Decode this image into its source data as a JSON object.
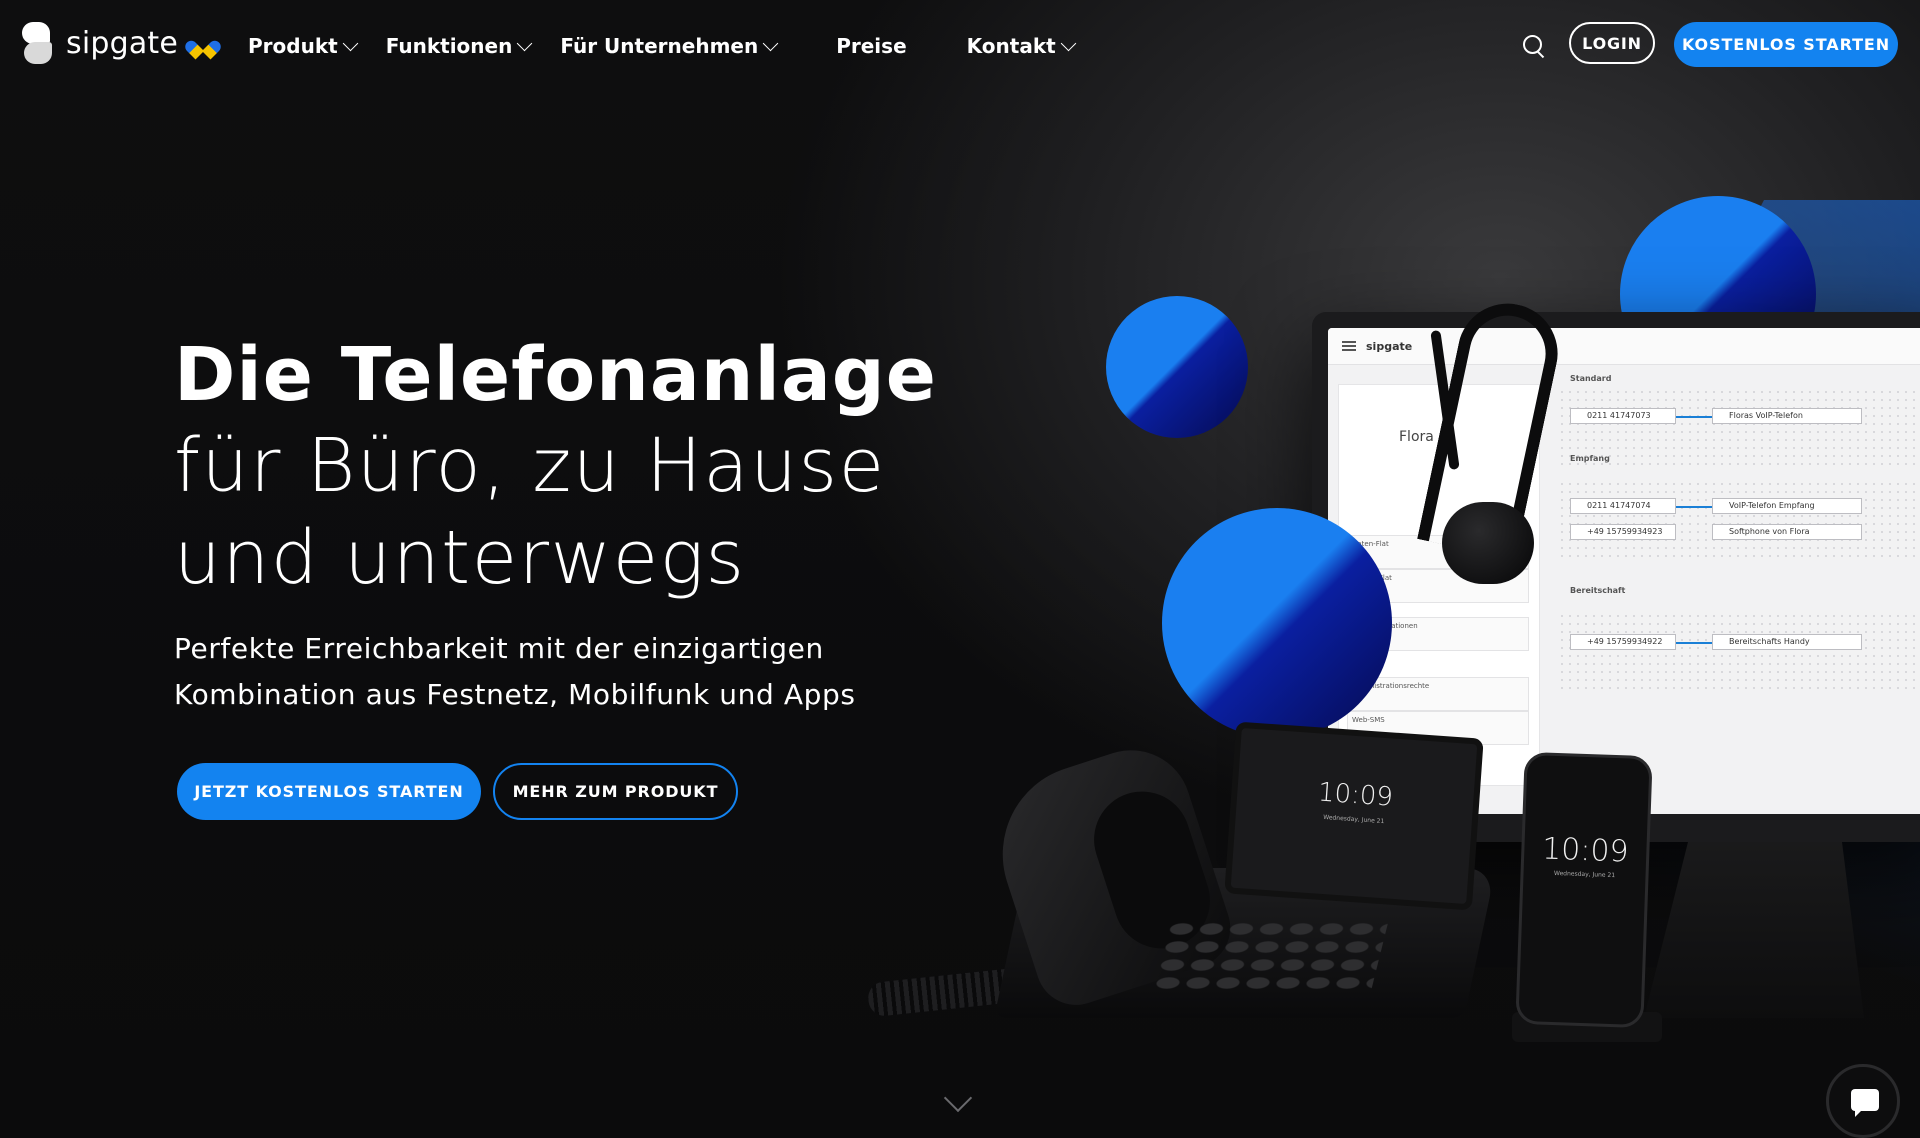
{
  "brand": {
    "name": "sipgate",
    "accent": "#1383f0"
  },
  "nav": {
    "items": [
      {
        "label": "Produkt",
        "dropdown": true
      },
      {
        "label": "Funktionen",
        "dropdown": true
      },
      {
        "label": "Für Unternehmen",
        "dropdown": true
      },
      {
        "label": "Preise",
        "dropdown": false
      },
      {
        "label": "Kontakt",
        "dropdown": true
      }
    ],
    "login_label": "LOGIN",
    "start_label": "KOSTENLOS STARTEN"
  },
  "hero": {
    "title_bold": "Die Telefonanlage",
    "title_light": [
      "für Büro, zu Hause",
      "und unterwegs"
    ],
    "subtitle": [
      "Perfekte Erreichbarkeit mit der einzigartigen",
      "Kombination aus Festnetz, Mobilfunk und Apps"
    ],
    "cta_primary": "JETZT KOSTENLOS STARTEN",
    "cta_secondary": "MEHR ZUM PRODUKT"
  },
  "device_screens": {
    "app_title": "sipgate",
    "user_name": "Flora",
    "sections": [
      "Standard",
      "Empfang",
      "Bereitschaft"
    ],
    "sidebar_cards": [
      "Daten-Flat",
      "Sprach-Flat",
      "CRM-Integrationen",
      "Administrationsrechte",
      "Web-SMS"
    ],
    "numbers": [
      "0211 41747073",
      "0211 41747074",
      "+49 15759934923",
      "+49 15759934922"
    ],
    "targets": [
      "Floras VoIP-Telefon",
      "VoIP-Telefon Empfang",
      "Softphone von Flora",
      "Bereitschafts Handy"
    ],
    "desk_time": "10:09",
    "phone_time": "10:09",
    "date": "Wednesday, June 21"
  },
  "icons": {
    "search": "search-icon",
    "chat": "chat-icon",
    "scroll": "chevron-down-icon",
    "heart": "ukraine-heart-icon"
  }
}
